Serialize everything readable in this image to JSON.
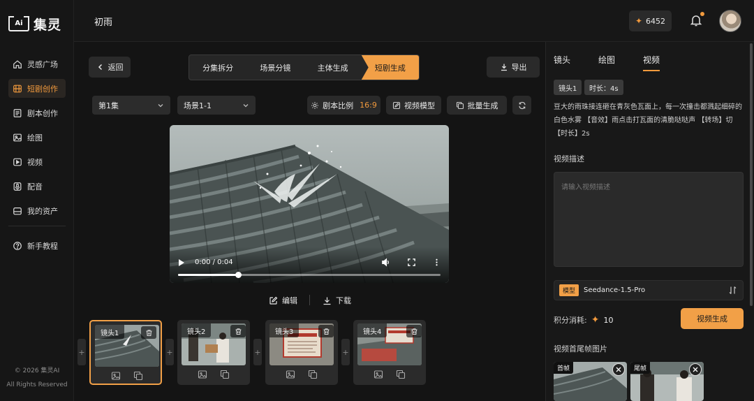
{
  "app": {
    "logo_mark": "Ai",
    "logo_text": "集灵",
    "project_title": "初雨"
  },
  "header": {
    "points": "6452"
  },
  "sidebar": {
    "items": [
      {
        "label": "灵感广场",
        "icon": "home-icon"
      },
      {
        "label": "短剧创作",
        "icon": "film-icon",
        "active": true
      },
      {
        "label": "剧本创作",
        "icon": "script-icon"
      },
      {
        "label": "绘图",
        "icon": "image-icon"
      },
      {
        "label": "视频",
        "icon": "play-icon"
      },
      {
        "label": "配音",
        "icon": "mic-icon"
      },
      {
        "label": "我的资产",
        "icon": "folder-icon"
      }
    ],
    "tutorial": "新手教程",
    "copyright_line1": "© 2026 集灵AI",
    "copyright_line2": "All Rights Reserved"
  },
  "toolbar": {
    "back": "返回",
    "steps": [
      "分集拆分",
      "场景分镜",
      "主体生成",
      "短剧生成"
    ],
    "active_step": 3,
    "export": "导出"
  },
  "filters": {
    "episode": "第1集",
    "scene": "场景1-1",
    "ratio_label": "剧本比例",
    "ratio_value": "16:9",
    "video_model": "视频模型",
    "batch": "批量生成"
  },
  "player": {
    "time": "0:00 / 0:04",
    "progress": 0.23
  },
  "actions": {
    "edit": "编辑",
    "download": "下载"
  },
  "shots": [
    {
      "label": "镜头1",
      "active": true
    },
    {
      "label": "镜头2"
    },
    {
      "label": "镜头3"
    },
    {
      "label": "镜头4"
    }
  ],
  "panel": {
    "tabs": [
      "镜头",
      "绘图",
      "视频"
    ],
    "active_tab": 2,
    "chip_shot": "镜头1",
    "chip_duration": "时长：4s",
    "description": "豆大的雨珠接连砸在青灰色瓦面上，每一次撞击都溅起细碎的白色水雾 【音效】雨点击打瓦面的清脆哒哒声 【转场】切 【时长】2s",
    "video_desc_label": "视频描述",
    "video_desc_placeholder": "请输入视频描述",
    "model_tag": "模型",
    "model_name": "Seedance-1.5-Pro",
    "cost_label": "积分消耗:",
    "cost_value": "10",
    "generate": "视频生成",
    "frames_label": "视频首尾帧图片",
    "first_frame": "首帧",
    "last_frame": "尾帧"
  },
  "colors": {
    "accent": "#f2a047",
    "background": "#141414",
    "panel": "#181818"
  }
}
